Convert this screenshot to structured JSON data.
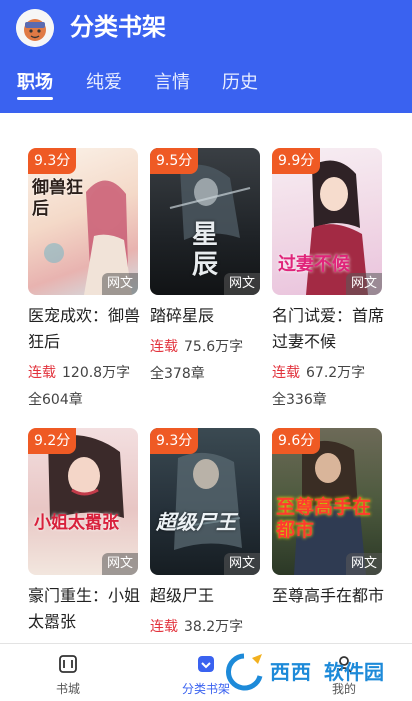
{
  "header": {
    "title": "分类书架",
    "tabs": [
      {
        "label": "职场",
        "active": true
      },
      {
        "label": "纯爱",
        "active": false
      },
      {
        "label": "言情",
        "active": false
      },
      {
        "label": "历史",
        "active": false
      }
    ],
    "brand_color": "#3a62f0"
  },
  "books": [
    {
      "score": "9.3分",
      "tag": "网文",
      "cover_text": "御兽狂后",
      "title": "医宠成欢：御兽狂后",
      "status": "连载",
      "words": "120.8万字",
      "chapters": "全604章"
    },
    {
      "score": "9.5分",
      "tag": "网文",
      "cover_text": "星辰",
      "title": "踏碎星辰",
      "status": "连载",
      "words": "75.6万字",
      "chapters": "全378章"
    },
    {
      "score": "9.9分",
      "tag": "网文",
      "cover_text": "过妻不候",
      "title": "名门试爱：首席过妻不候",
      "status": "连载",
      "words": "67.2万字",
      "chapters": "全336章"
    },
    {
      "score": "9.2分",
      "tag": "网文",
      "cover_text": "小姐太嚣张",
      "title": "豪门重生：小姐太嚣张",
      "status": "",
      "words": "",
      "chapters": ""
    },
    {
      "score": "9.3分",
      "tag": "网文",
      "cover_text": "超级尸王",
      "title": "超级尸王",
      "status": "连载",
      "words": "38.2万字",
      "chapters": ""
    },
    {
      "score": "9.6分",
      "tag": "网文",
      "cover_text": "至尊高手在都市",
      "title": "至尊高手在都市",
      "status": "",
      "words": "",
      "chapters": ""
    }
  ],
  "bottom_nav": [
    {
      "label": "书城",
      "icon": "book-city-icon",
      "active": false
    },
    {
      "label": "分类书架",
      "icon": "bookshelf-icon",
      "active": true
    },
    {
      "label": "我的",
      "icon": "profile-icon",
      "active": false
    }
  ],
  "watermark": {
    "text1": "西西",
    "text2": "软件园"
  }
}
